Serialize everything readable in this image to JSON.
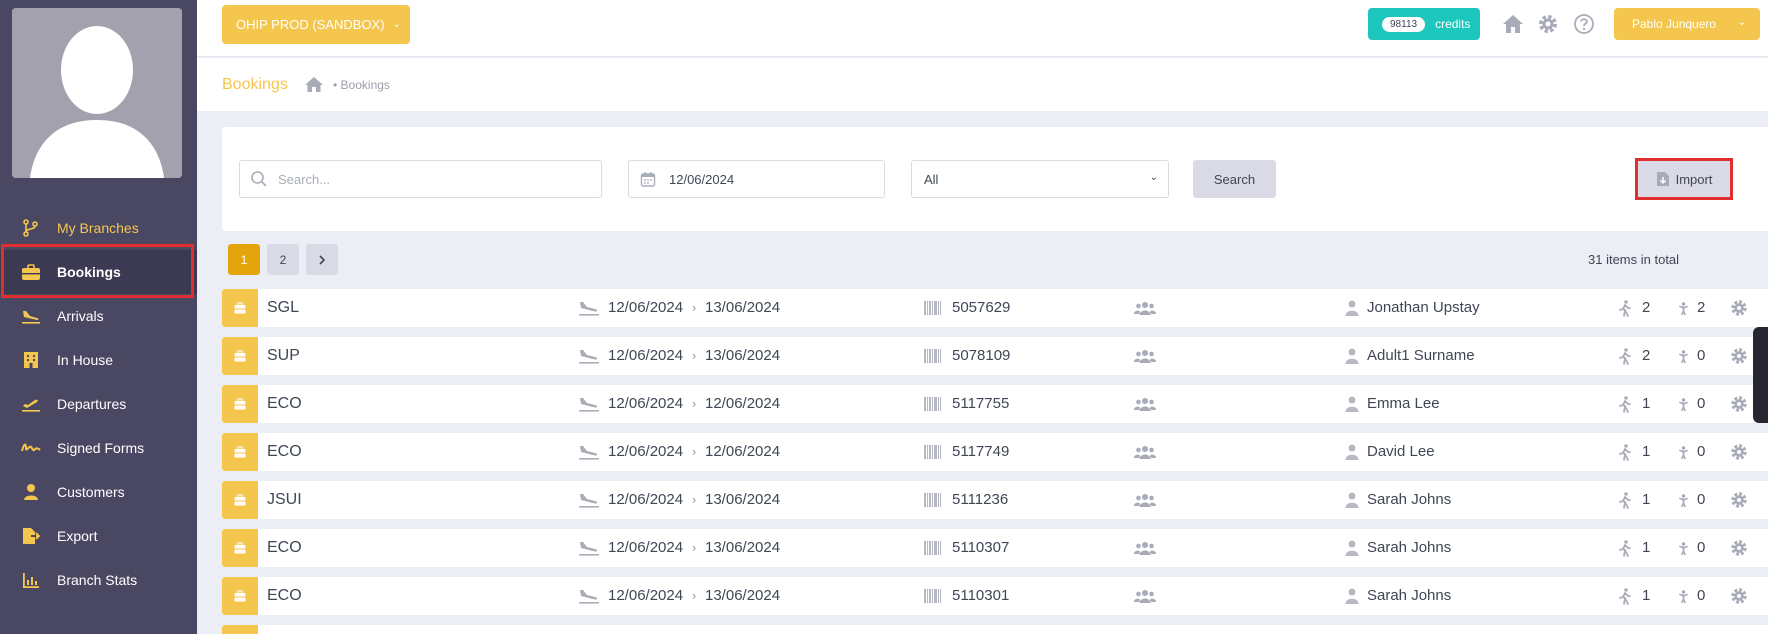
{
  "header": {
    "environment_label": "OHIP PROD (SANDBOX)",
    "credits_count": "98113",
    "credits_label": "credits",
    "user_name": "Pablo Junquero"
  },
  "breadcrumb": {
    "title": "Bookings",
    "current": "Bookings"
  },
  "sidebar": {
    "items": [
      {
        "label": "My Branches",
        "icon": "branch-icon"
      },
      {
        "label": "Bookings",
        "icon": "briefcase-icon"
      },
      {
        "label": "Arrivals",
        "icon": "plane-landing-icon"
      },
      {
        "label": "In House",
        "icon": "building-icon"
      },
      {
        "label": "Departures",
        "icon": "plane-takeoff-icon"
      },
      {
        "label": "Signed Forms",
        "icon": "signature-icon"
      },
      {
        "label": "Customers",
        "icon": "user-icon"
      },
      {
        "label": "Export",
        "icon": "file-export-icon"
      },
      {
        "label": "Branch Stats",
        "icon": "bar-chart-icon"
      }
    ]
  },
  "filters": {
    "search_placeholder": "Search...",
    "date_value": "12/06/2024",
    "status_value": "All",
    "search_button": "Search",
    "import_button": "Import"
  },
  "pagination": {
    "page1": "1",
    "page2": "2",
    "next": "›",
    "total_text": "31 items in total"
  },
  "bookings": [
    {
      "room_type": "SGL",
      "arrival": "12/06/2024",
      "departure": "13/06/2024",
      "reference": "5057629",
      "guest": "Jonathan Upstay",
      "adults": "2",
      "children": "2"
    },
    {
      "room_type": "SUP",
      "arrival": "12/06/2024",
      "departure": "13/06/2024",
      "reference": "5078109",
      "guest": "Adult1 Surname",
      "adults": "2",
      "children": "0"
    },
    {
      "room_type": "ECO",
      "arrival": "12/06/2024",
      "departure": "12/06/2024",
      "reference": "5117755",
      "guest": "Emma Lee",
      "adults": "1",
      "children": "0"
    },
    {
      "room_type": "ECO",
      "arrival": "12/06/2024",
      "departure": "12/06/2024",
      "reference": "5117749",
      "guest": "David Lee",
      "adults": "1",
      "children": "0"
    },
    {
      "room_type": "JSUI",
      "arrival": "12/06/2024",
      "departure": "13/06/2024",
      "reference": "5111236",
      "guest": "Sarah Johns",
      "adults": "1",
      "children": "0"
    },
    {
      "room_type": "ECO",
      "arrival": "12/06/2024",
      "departure": "13/06/2024",
      "reference": "5110307",
      "guest": "Sarah Johns",
      "adults": "1",
      "children": "0"
    },
    {
      "room_type": "ECO",
      "arrival": "12/06/2024",
      "departure": "13/06/2024",
      "reference": "5110301",
      "guest": "Sarah Johns",
      "adults": "1",
      "children": "0"
    }
  ],
  "colors": {
    "accent": "#f5c64d",
    "sidebar": "#4a4763",
    "credits": "#1ec7bd",
    "highlight": "#e12d2d"
  }
}
